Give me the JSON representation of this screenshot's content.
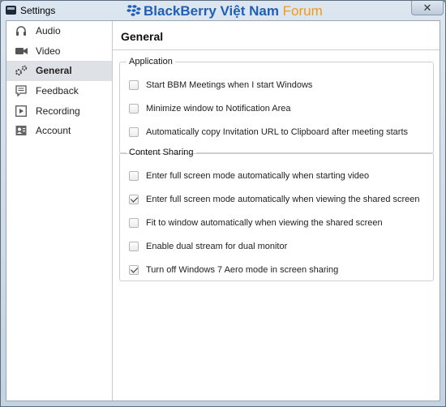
{
  "window": {
    "title": "Settings",
    "close_glyph": "✕"
  },
  "brand": {
    "main": "BlackBerry Việt Nam ",
    "accent": "Forum"
  },
  "sidebar": {
    "items": [
      {
        "label": "Audio",
        "icon": "headphones-icon",
        "active": false
      },
      {
        "label": "Video",
        "icon": "video-camera-icon",
        "active": false
      },
      {
        "label": "General",
        "icon": "gears-icon",
        "active": true
      },
      {
        "label": "Feedback",
        "icon": "speech-bubble-icon",
        "active": false
      },
      {
        "label": "Recording",
        "icon": "record-play-icon",
        "active": false
      },
      {
        "label": "Account",
        "icon": "account-card-icon",
        "active": false
      }
    ]
  },
  "main": {
    "heading": "General",
    "application": {
      "title": "Application",
      "options": [
        {
          "label": "Start BBM Meetings when I start Windows",
          "checked": false
        },
        {
          "label": "Minimize window to Notification Area",
          "checked": false
        },
        {
          "label": "Automatically copy Invitation URL to Clipboard after meeting starts",
          "checked": false
        }
      ]
    },
    "content_sharing": {
      "title": "Content Sharing",
      "options": [
        {
          "label": "Enter full screen mode automatically when starting video",
          "checked": false
        },
        {
          "label": "Enter full screen mode automatically when viewing the shared screen",
          "checked": true
        },
        {
          "label": "Fit to window automatically when viewing the shared screen",
          "checked": false
        },
        {
          "label": "Enable dual stream for dual monitor",
          "checked": false
        },
        {
          "label": "Turn off Windows 7 Aero mode in screen sharing",
          "checked": true
        }
      ]
    }
  }
}
